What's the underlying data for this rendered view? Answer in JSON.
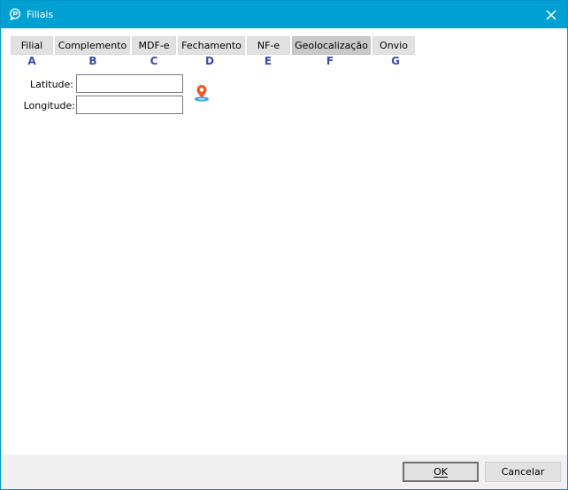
{
  "window": {
    "title": "Filiais"
  },
  "tabs": [
    {
      "label": "Filial",
      "letter": "A"
    },
    {
      "label": "Complemento",
      "letter": "B"
    },
    {
      "label": "MDF-e",
      "letter": "C"
    },
    {
      "label": "Fechamento",
      "letter": "D"
    },
    {
      "label": "NF-e",
      "letter": "E"
    },
    {
      "label": "Geolocalização",
      "letter": "F",
      "active": true
    },
    {
      "label": "Onvio",
      "letter": "G"
    }
  ],
  "form": {
    "latitude_label": "Latitude:",
    "latitude_value": "",
    "longitude_label": "Longitude:",
    "longitude_value": ""
  },
  "icons": {
    "app": "chat-bubble-icon",
    "close": "close-icon",
    "map": "map-pin-icon"
  },
  "footer": {
    "ok_label": "OK",
    "cancel_label": "Cancelar"
  },
  "colors": {
    "titlebar": "#00a0d2",
    "tab_letter": "#3a4aa8",
    "pin": "#f05a28"
  }
}
